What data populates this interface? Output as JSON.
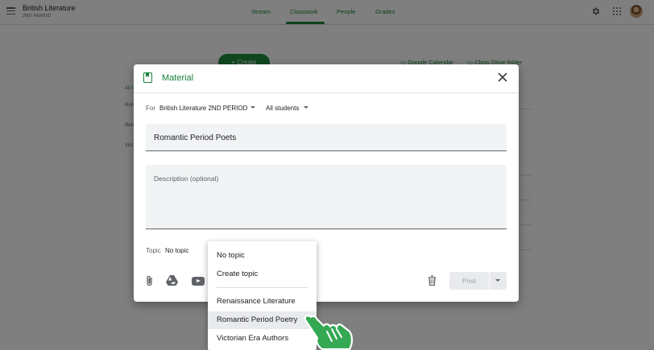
{
  "header": {
    "class_title": "British Literature",
    "class_subtitle": "2ND PERIOD",
    "tabs": [
      {
        "label": "Stream",
        "active": false
      },
      {
        "label": "Classwork",
        "active": true
      },
      {
        "label": "People",
        "active": false
      },
      {
        "label": "Grades",
        "active": false
      }
    ]
  },
  "background": {
    "create_label": "Create",
    "calendar_label": "Google Calendar",
    "drive_folder_label": "Class Drive folder",
    "sidebar": [
      "All t",
      "Rom",
      "Ren",
      "Vict"
    ]
  },
  "dialog": {
    "title": "Material",
    "for_label": "For",
    "for_class": "British Literature 2ND PERIOD",
    "students": "All students",
    "title_value": "Romantic Period Poets",
    "description_placeholder": "Description (optional)",
    "topic_label": "Topic",
    "topic_value": "No topic",
    "post_label": "Post"
  },
  "topic_menu": {
    "items": [
      {
        "label": "No topic"
      },
      {
        "label": "Create topic"
      },
      {
        "label": "Renaissance Literature"
      },
      {
        "label": "Romantic Period Poetry",
        "highlighted": true
      },
      {
        "label": "Victorian Era Authors"
      }
    ]
  },
  "colors": {
    "accent": "#188038",
    "scrim": "rgba(0,0,0,0.5)",
    "cursor": "#34a853"
  },
  "icons": [
    "menu-icon",
    "settings-icon",
    "apps-icon",
    "avatar",
    "material-icon",
    "close-icon",
    "attachment-icon",
    "google-drive-icon",
    "youtube-icon",
    "trash-icon",
    "hand-cursor-icon"
  ]
}
